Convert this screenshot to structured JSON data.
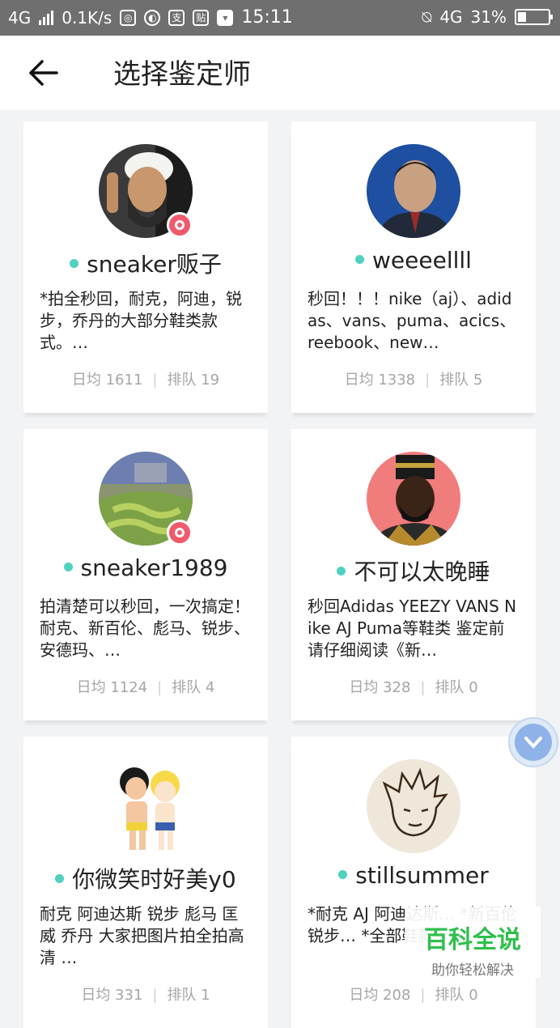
{
  "status_bar": {
    "network": "4G",
    "speed": "0.1K/s",
    "time": "15:11",
    "network_right": "4G",
    "battery": "31%"
  },
  "header": {
    "title": "选择鉴定师",
    "back_icon": "arrow-left-icon"
  },
  "cards": [
    {
      "name": "sneaker贩子",
      "desc": "*拍全秒回，耐克，阿迪，锐步，乔丹的大部分鞋类款式。…",
      "daily_label": "日均 1611",
      "queue_label": "排队 19",
      "verified": true
    },
    {
      "name": "weeeellll",
      "desc": "秒回！！！nike（aj）、adidas、vans、puma、acics、reebook、new…",
      "daily_label": "日均 1338",
      "queue_label": "排队 5",
      "verified": false
    },
    {
      "name": "sneaker1989",
      "desc": "拍清楚可以秒回，一次搞定！耐克、新百伦、彪马、锐步、安德玛、…",
      "daily_label": "日均 1124",
      "queue_label": "排队 4",
      "verified": true
    },
    {
      "name": "不可以太晚睡",
      "desc": "秒回Adidas YEEZY VANS Nike AJ Puma等鞋类 鉴定前请仔细阅读《新…",
      "daily_label": "日均 328",
      "queue_label": "排队 0",
      "verified": false
    },
    {
      "name": "你微笑时好美y0",
      "desc": "耐克 阿迪达斯 锐步 彪马 匡威 乔丹 大家把图片拍全拍高清 …",
      "daily_label": "日均 331",
      "queue_label": "排队 1",
      "verified": false
    },
    {
      "name": "stillsummer",
      "desc": "*耐克 AJ 阿迪达斯… *新百伦 锐步… *全部鞋款+…",
      "daily_label": "日均 208",
      "queue_label": "排队 0",
      "verified": false
    }
  ],
  "watermark": {
    "title": "百科全说",
    "subtitle": "助你轻松解决"
  },
  "colors": {
    "online_dot": "#4fd2bf",
    "badge": "#ef5b6c",
    "background": "#f2f3f5"
  }
}
